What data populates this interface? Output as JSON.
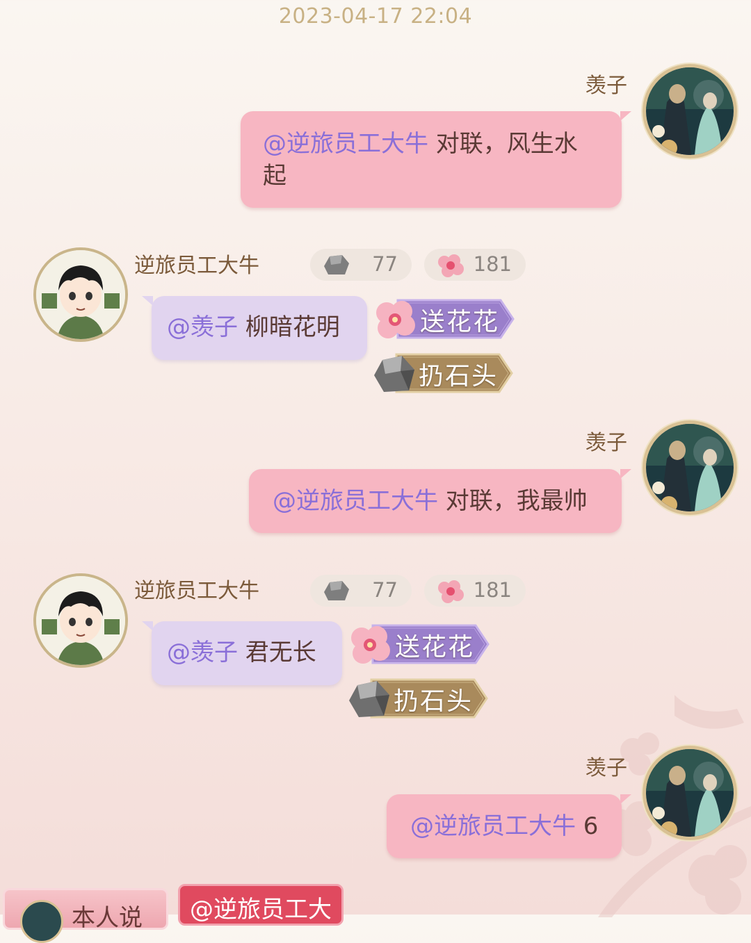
{
  "timestamp": "2023-04-17 22:04",
  "colors": {
    "pink_bubble": "#f7b6c2",
    "purple_bubble": "#e1d4ef",
    "mention": "#8a6fd8",
    "name": "#7b5a3a"
  },
  "messages": [
    {
      "sender": "羡子",
      "mention": "@逆旅员工大牛",
      "text_line1": " 对联，风生水",
      "text_line2": "起"
    },
    {
      "sender": "逆旅员工大牛",
      "stone_count": "77",
      "flower_count": "181",
      "mention": "@羡子",
      "text": " 柳暗花明",
      "flower_action": "送花花",
      "stone_action": "扔石头"
    },
    {
      "sender": "羡子",
      "mention": "@逆旅员工大牛",
      "text": " 对联，我最帅"
    },
    {
      "sender": "逆旅员工大牛",
      "stone_count": "77",
      "flower_count": "181",
      "mention": "@羡子",
      "text": " 君无长",
      "flower_action": "送花花",
      "stone_action": "扔石头"
    },
    {
      "sender": "羡子",
      "mention": "@逆旅员工大牛",
      "text": " 6"
    }
  ],
  "bottom_bar": {
    "left_button": "本人说",
    "mention_chip": "@逆旅员工大"
  },
  "icons": {
    "stone": "stone-icon",
    "flower": "flower-icon"
  }
}
